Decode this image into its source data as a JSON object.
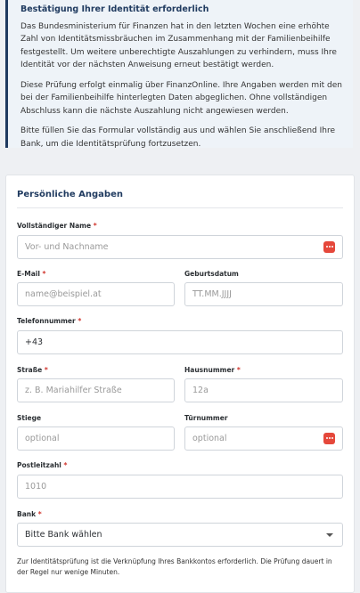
{
  "notice": {
    "title": "Bestätigung Ihrer Identität erforderlich",
    "p1": "Das Bundesministerium für Finanzen hat in den letzten Wochen eine erhöhte Zahl von Identitätsmissbräuchen im Zusammenhang mit der Familienbeihilfe festgestellt. Um weitere unberechtigte Auszahlungen zu verhindern, muss Ihre Identität vor der nächsten Anweisung erneut bestätigt werden.",
    "p2": "Diese Prüfung erfolgt einmalig über FinanzOnline. Ihre Angaben werden mit den bei der Familienbeihilfe hinterlegten Daten abgeglichen. Ohne vollständigen Abschluss kann die nächste Auszahlung nicht angewiesen werden.",
    "p3": "Bitte füllen Sie das Formular vollständig aus und wählen Sie anschließend Ihre Bank, um die Identitätsprüfung fortzusetzen."
  },
  "form": {
    "section_title": "Persönliche Angaben",
    "required_mark": "*",
    "name": {
      "label": "Vollständiger Name",
      "placeholder": "Vor- und Nachname"
    },
    "email": {
      "label": "E-Mail",
      "placeholder": "name@beispiel.at"
    },
    "birthdate": {
      "label": "Geburtsdatum",
      "placeholder": "TT.MM.JJJJ"
    },
    "phone": {
      "label": "Telefonnummer",
      "value": "+43"
    },
    "street": {
      "label": "Straße",
      "placeholder": "z. B. Mariahilfer Straße"
    },
    "house": {
      "label": "Hausnummer",
      "placeholder": "12a"
    },
    "stair": {
      "label": "Stiege",
      "placeholder": "optional"
    },
    "door": {
      "label": "Türnummer",
      "placeholder": "optional"
    },
    "zip": {
      "label": "Postleitzahl",
      "placeholder": "1010"
    },
    "bank": {
      "label": "Bank",
      "selected": "Bitte Bank wählen"
    },
    "footnote": "Zur Identitätsprüfung ist die Verknüpfung Ihres Bankkontos erforderlich. Die Prüfung dauert in der Regel nur wenige Minuten."
  },
  "colors": {
    "accent": "#1f3a5f",
    "required": "#d0342c",
    "icon": "#e5483b"
  },
  "icons": {
    "password_manager": "dots-icon",
    "select": "chevron-down-icon"
  }
}
